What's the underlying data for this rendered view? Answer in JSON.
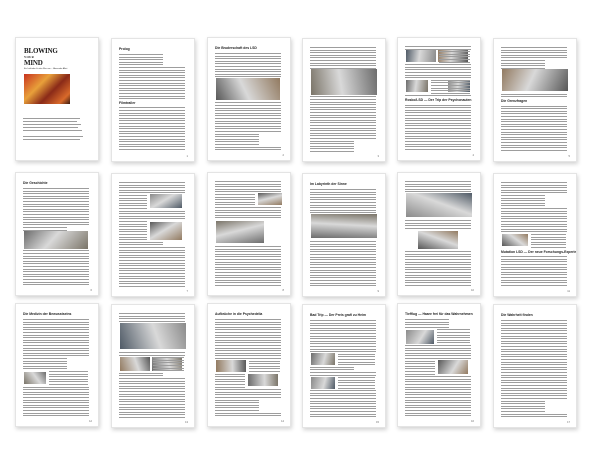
{
  "document": {
    "cover_title_line1": "BLOWING",
    "cover_title_line2": "YOUR",
    "cover_title_line3": "MIND",
    "cover_subtitle": "Ein Leitfaden für den Film von ... Alexander Alfert",
    "pages": [
      {
        "heading": "",
        "number": ""
      },
      {
        "heading": "Prolog",
        "number": "1",
        "heading2": "Filmtrailer"
      },
      {
        "heading": "Die Bruderschaft des LSD",
        "number": "2"
      },
      {
        "heading": "",
        "number": "3"
      },
      {
        "heading": "",
        "number": "4",
        "heading2": "Rosko/LSD — Der Trip der Psychonauten"
      },
      {
        "heading": "",
        "number": "5",
        "heading2": "Die Grenzfragen"
      },
      {
        "heading": "Die Geschichte",
        "number": "6"
      },
      {
        "heading": "",
        "number": "7"
      },
      {
        "heading": "",
        "number": "8"
      },
      {
        "heading": "Im Labyrinth der Sinne",
        "number": "9"
      },
      {
        "heading": "",
        "number": "10"
      },
      {
        "heading": "",
        "number": "11",
        "heading2": "Mutation LSD — Der neue Forschungs-Experiment"
      },
      {
        "heading": "Die Medizin der Bewusstseins",
        "number": "12"
      },
      {
        "heading": "",
        "number": "13"
      },
      {
        "heading": "Aufbrüche in die Psychedelia",
        "number": "14"
      },
      {
        "heading": "Bad Trip — Der Preis grafi zu Heim",
        "number": "15"
      },
      {
        "heading": "Tiefflug — Haare frei für das Wahrnehmen",
        "number": "16"
      },
      {
        "heading": "Die Wahrheit finden",
        "number": "17"
      }
    ]
  }
}
